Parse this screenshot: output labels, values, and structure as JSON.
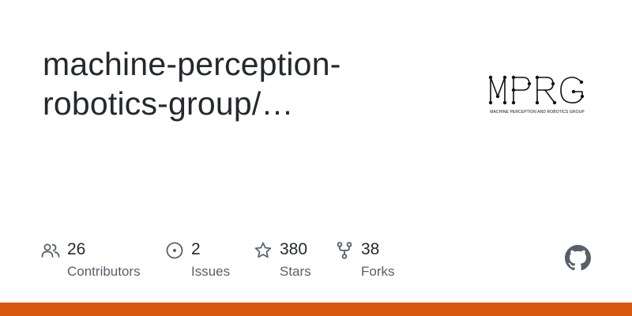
{
  "repo": {
    "title_line1": "machine-perception-",
    "title_line2": "robotics-group/…"
  },
  "logo": {
    "wordmark": "MPRG",
    "caption": "MACHINE PERCEPTION AND ROBOTICS GROUP"
  },
  "stats": [
    {
      "count": "26",
      "label": "Contributors",
      "icon": "people-icon"
    },
    {
      "count": "2",
      "label": "Issues",
      "icon": "issue-opened-icon"
    },
    {
      "count": "380",
      "label": "Stars",
      "icon": "star-icon"
    },
    {
      "count": "38",
      "label": "Forks",
      "icon": "repo-forked-icon"
    }
  ],
  "brand": {
    "icon": "github-mark-icon",
    "bar_color": "#d9570f",
    "icon_color": "#57606a"
  }
}
